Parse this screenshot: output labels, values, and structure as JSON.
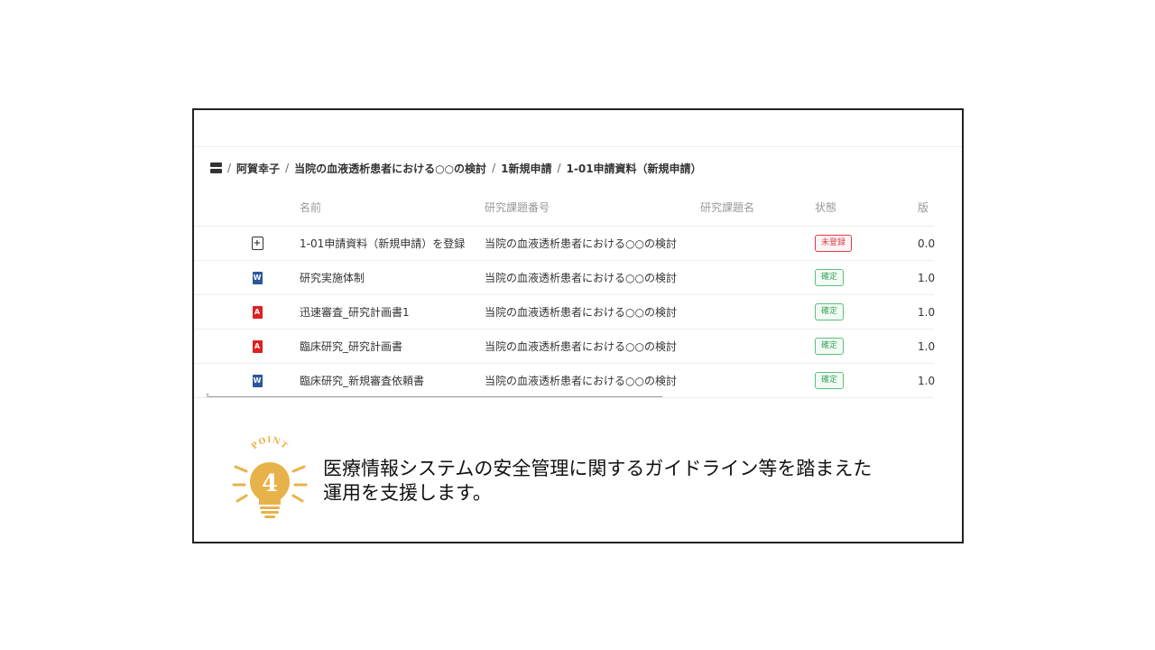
{
  "breadcrumb": {
    "home_icon": "home-icon",
    "items": [
      "阿賀幸子",
      "当院の血液透析患者における○○の検討",
      "1新規申請",
      "1-01申請資料（新規申請）"
    ],
    "separator": "/"
  },
  "table": {
    "headers": {
      "name": "名前",
      "number": "研究課題番号",
      "title": "研究課題名",
      "status": "状態",
      "version": "版"
    },
    "rows": [
      {
        "icon": "add-file-icon",
        "name": "1-01申請資料（新規申請）を登録",
        "number": "当院の血液透析患者における○○の検討",
        "title": "",
        "status": "未登録",
        "version": "0.0"
      },
      {
        "icon": "word-file-icon",
        "name": "研究実施体制",
        "number": "当院の血液透析患者における○○の検討",
        "title": "",
        "status": "確定",
        "version": "1.0"
      },
      {
        "icon": "pdf-file-icon",
        "name": "迅速審査_研究計画書1",
        "number": "当院の血液透析患者における○○の検討",
        "title": "",
        "status": "確定",
        "version": "1.0"
      },
      {
        "icon": "pdf-file-icon",
        "name": "臨床研究_研究計画書",
        "number": "当院の血液透析患者における○○の検討",
        "title": "",
        "status": "確定",
        "version": "1.0"
      },
      {
        "icon": "word-file-icon",
        "name": "臨床研究_新規審査依頼書",
        "number": "当院の血液透析患者における○○の検討",
        "title": "",
        "status": "確定",
        "version": "1.0"
      }
    ],
    "icon_letters": {
      "word": "W",
      "pdf": "A",
      "add": "+"
    }
  },
  "point": {
    "label": "POINT",
    "number": "4",
    "lines": [
      "医療情報システムの安全管理に関するガイドライン等を踏まえた",
      "運用を支援します。"
    ]
  },
  "colors": {
    "word": "#2b579a",
    "pdf": "#e02020",
    "unregistered": "#e03a4a",
    "confirmed": "#3aa560",
    "bulb": "#e8b24a"
  }
}
